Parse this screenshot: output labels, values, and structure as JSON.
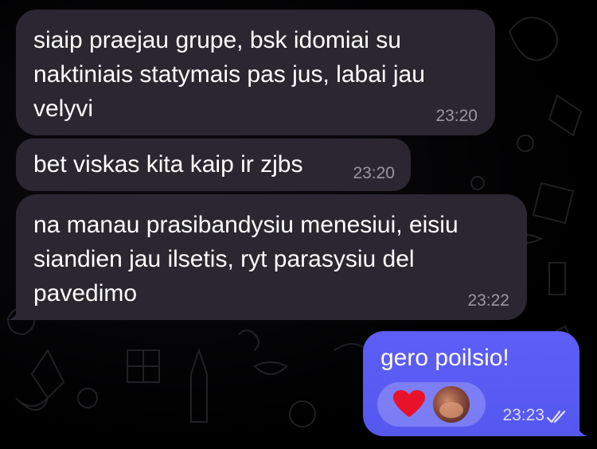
{
  "messages": [
    {
      "text": "siaip praejau grupe, bsk idomiai su naktiniais statymais pas jus, labai jau velyvi",
      "time": "23:20"
    },
    {
      "text": "bet viskas kita kaip ir zjbs",
      "time": "23:20"
    },
    {
      "text": "na manau prasibandysiu menesiui, eisiu siandien jau ilsetis, ryt parasysiu del pavedimo",
      "time": "23:22"
    }
  ],
  "outgoing": {
    "text": "gero poilsio!",
    "time": "23:23",
    "status_icon": "double-check-icon",
    "reaction_icon": "red-heart-icon"
  },
  "colors": {
    "incoming_bubble": "#2a2730",
    "outgoing_bubble": "#5b5cf5",
    "heart": "#e8122a"
  }
}
